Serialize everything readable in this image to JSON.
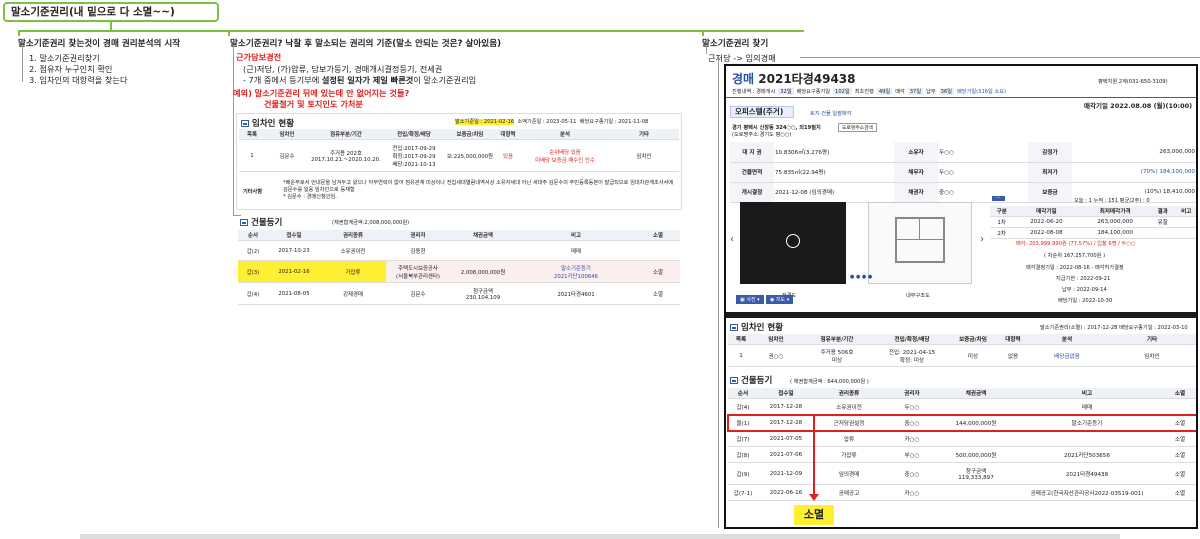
{
  "root": {
    "title": "말소기준권리(내 밑으로 다 소멸~~)"
  },
  "col1": {
    "title": "말소기준권리 찾는것이 경매 권리분석의 시작",
    "items": [
      "1. 말소기준권리찾기",
      "2. 점유자 누구인지 확인",
      "3. 임차인의 대항력을 찾는다"
    ]
  },
  "col2": {
    "title": "말소기준권리? 낙찰 후 말소되는 권리의 기준(말소 안되는 것은? 살아있음)",
    "sub1": "근가담보경전",
    "line1": "(근)저당, (가)압류, 담보가등기, 경매개시결정등기, 전세권",
    "line2": "- 7개 중에서 등기부에 설정된 일자가 제일 빠른것이 말소기준권리임",
    "line2a": "- 7개 중에서 등기부에 ",
    "line2b": "설정된 일자가 제일 빠른것",
    "line2c": "이 말소기준권리임",
    "exc1": "예외) 말소기준권리 뒤에 있는데 안 없어지는 것들?",
    "exc2": "건물철거 및 토지인도 가처분"
  },
  "col3": {
    "title": "말소기준권리 찾기",
    "sub": "근저당 -> 임의경매"
  },
  "mid": {
    "hdrline": {
      "a": "말소기준일 : 2021-02-16",
      "b": "소액기준일 : 2023-05-11",
      "c": "배당요구종기일 : 2021-11-08"
    },
    "tenant": {
      "title": "임차인 현황",
      "cols": [
        "목록",
        "임차인",
        "점유부분/기간",
        "전입/확정/배당",
        "보증금/차임",
        "대항력",
        "분석",
        "기타"
      ],
      "row": [
        "1",
        "김문수",
        "주거용 202호\n2017.10.21.~2020.10.20.",
        "전입:2017-09-29\n확정:2017-09-29\n배당:2021-10-13",
        "보:225,000,000원",
        "있음",
        "순위배당 있음\n미배당 보증금 매수인 인수",
        "임차인"
      ],
      "etcLabel": "기타사항",
      "etc1": "*배운부로서 언내문을 남겨두고 왔으나 아무연락이 없어 점유관계 미상이나 전입세대열람내역서상 소유자세대 아닌 세대주 김문수의 주민등록등본이 발급되므로 임대차관계조사서에 김문수를 일응 임차인으로 등재함",
      "etc2": "* 김문수 : 경매신청인임."
    },
    "reg": {
      "title": "건물등기",
      "note": "(채권합계금액:2,008,000,000원)",
      "cols": [
        "순서",
        "접수일",
        "권리종류",
        "권리자",
        "채권금액",
        "비고",
        "소멸"
      ],
      "rows": [
        [
          "갑(2)",
          "2017-10-23",
          "소유권이전",
          "김동현",
          "",
          "매매",
          ""
        ],
        [
          "갑(3)",
          "2021-02-16",
          "가압류",
          "주택도시보증공사\n(서울북부관리센터)",
          "2,008,000,000원",
          "말소기준등기\n2021카단100646",
          "소멸"
        ],
        [
          "갑(4)",
          "2021-08-05",
          "강제경매",
          "김문수",
          "청구금액\n230,104,109",
          "2021타경4601",
          "소멸"
        ]
      ]
    }
  },
  "right": {
    "title1": "경매",
    "title2": "2021타경49438",
    "phone": "평택지원 2계(031-650-3109)",
    "chips": [
      "진행내역 : 경매개시",
      "32일",
      "배당요구종기일",
      "102일",
      "최초진행",
      "49일",
      "매각",
      "37일",
      "납부",
      "36일",
      "배당기일(316일 소요)"
    ],
    "sold": "매각기일 2022.08.08 (월)(10:00)",
    "kind": "오피스텔(주거)",
    "kindnote": "토지·건물 일괄매각",
    "addr": "경기 평택시 신장동 324○○, 외19필지",
    "addr2": "(도로명주소:경기도 평○○)",
    "addrbtn": "도로명주소검색",
    "info": [
      [
        "대 지 권",
        "10.8306㎡(3.276평)",
        "소유자",
        "두○○",
        "감정가",
        "263,000,000"
      ],
      [
        "건물면적",
        "75.835㎡(22.94평)",
        "채무자",
        "두○○",
        "최저가",
        "(70%) 184,100,000"
      ],
      [
        "개시결정",
        "2021-12-08 (임의경매)",
        "채권자",
        "중○○",
        "보증금",
        "(10%) 18,410,000"
      ]
    ],
    "photo1": "전경도",
    "photo2": "내부구조도",
    "stats": "오늘 : 1  누적 : 151  평균(2주) : 0",
    "bidcols": [
      "구분",
      "매각기일",
      "최저매각가격",
      "결과",
      "비고"
    ],
    "bids": [
      [
        "1차",
        "2022-06-20",
        "263,000,000",
        "유찰"
      ],
      [
        "2차",
        "2022-08-08",
        "184,100,000",
        ""
      ]
    ],
    "bidresult": "매각: 203,999,990원 (77.57%) / 입찰 6명 / 두○○",
    "bidsub": "( 차순위 167,257,700원 )",
    "decision": "매각결정기일 : 2022-08-16 - 매각허가결정",
    "deadline": "지급기한 : 2022-09-21",
    "paid": "납부 : 2022-09-14",
    "div": "배당기일 : 2022-10-30",
    "photobtn1": "사진",
    "photobtn2": "지도",
    "tenanthdr": "말소기준권리(소멸) : 2017-12-28  배당요구종기일 : 2022-03-10",
    "tenantTitle": "임차인 현황",
    "tcols": [
      "목록",
      "임차인",
      "점유부분/기간",
      "전입/확정/배당",
      "보증금/차임",
      "대항력",
      "분석",
      "기타"
    ],
    "trow": [
      "1",
      "권○○",
      "주거용 506호\n미상",
      "전입: 2021-04-15\n확정: 미상",
      "미상",
      "없음",
      "배당금없음",
      "임차인"
    ],
    "regTitle": "건물등기",
    "regNote": "( 채권합계금액 : 644,000,000원 )",
    "rcols": [
      "순서",
      "접수일",
      "권리종류",
      "권리자",
      "채권금액",
      "비고",
      "소멸"
    ],
    "rrows": [
      [
        "갑(4)",
        "2017-12-28",
        "소유권이전",
        "두○○",
        "",
        "매매",
        ""
      ],
      [
        "을(1)",
        "2017-12-28",
        "근저당권설정",
        "중○○",
        "144,000,000원",
        "말소기준등기",
        "소멸"
      ],
      [
        "갑(7)",
        "2021-07-05",
        "압류",
        "카○○",
        "",
        "",
        "소멸"
      ],
      [
        "갑(8)",
        "2021-07-06",
        "가압류",
        "부○○",
        "500,000,000원",
        "2021카단503656",
        "소멸"
      ],
      [
        "갑(9)",
        "2021-12-09",
        "임의경매",
        "중○○",
        "청구금액\n119,333,897",
        "2021타경49438",
        "소멸"
      ],
      [
        "갑(7-1)",
        "2022-06-16",
        "공매공고",
        "카○○",
        "",
        "공매공고(한국자산관리공사2022-03519-001)",
        "소멸"
      ]
    ],
    "somyeol": "소멸"
  },
  "colors": {
    "green": "#7cc242",
    "red": "#e02020",
    "blue": "#2a4fa8",
    "yellow": "#ffef33"
  }
}
